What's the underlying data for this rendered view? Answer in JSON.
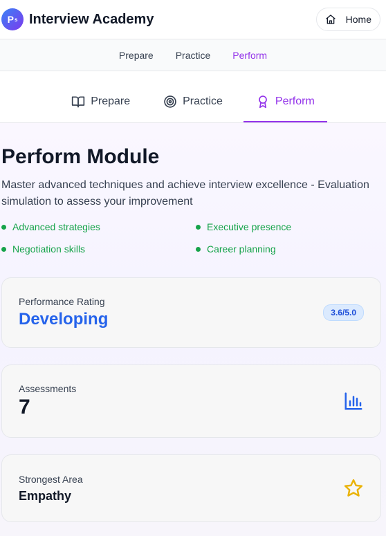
{
  "header": {
    "logo_text": "P",
    "logo_sup": "s",
    "title": "Interview Academy",
    "home_label": "Home"
  },
  "subnav": {
    "items": [
      "Prepare",
      "Practice",
      "Perform"
    ],
    "active": "Perform"
  },
  "tabs": {
    "items": [
      "Prepare",
      "Practice",
      "Perform"
    ],
    "active": "Perform"
  },
  "main": {
    "title": "Perform Module",
    "description": "Master advanced techniques and achieve interview excellence - Evaluation simulation to assess your improvement",
    "features": [
      "Advanced strategies",
      "Executive presence",
      "Negotiation skills",
      "Career planning"
    ]
  },
  "cards": {
    "rating": {
      "label": "Performance Rating",
      "value": "Developing",
      "badge": "3.6/5.0"
    },
    "assessments": {
      "label": "Assessments",
      "value": "7",
      "icon": "bar-chart-icon"
    },
    "strongest": {
      "label": "Strongest Area",
      "value": "Empathy",
      "icon": "star-icon"
    }
  },
  "colors": {
    "accent": "#9333ea",
    "rating_blue": "#2563eb",
    "feature_green": "#16a34a",
    "star_gold": "#eab308"
  }
}
